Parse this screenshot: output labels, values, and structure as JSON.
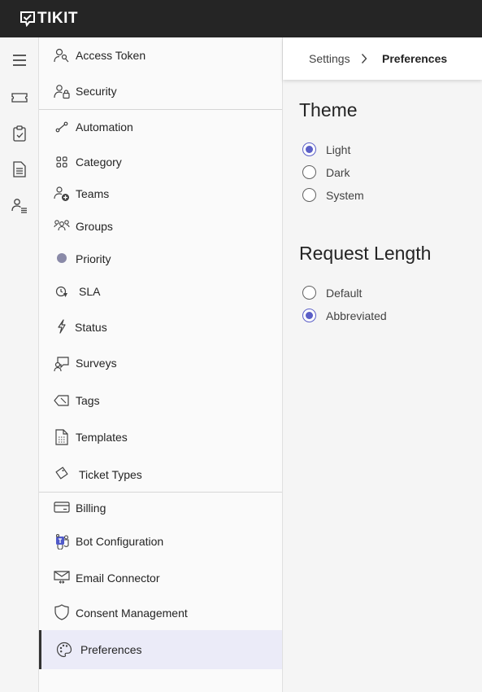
{
  "app": {
    "name": "TIKIT"
  },
  "rail": {
    "icons": [
      "hamburger-menu-icon",
      "ticket-icon",
      "clipboard-task-icon",
      "document-icon",
      "people-list-icon"
    ]
  },
  "nav": {
    "items": [
      {
        "label": "Access Token",
        "icon": "person-key-icon"
      },
      {
        "label": "Security",
        "icon": "people-lock-icon"
      },
      {
        "label": "Automation",
        "icon": "flow-icon"
      },
      {
        "label": "Category",
        "icon": "grid-icon"
      },
      {
        "label": "Teams",
        "icon": "people-add-icon"
      },
      {
        "label": "Groups",
        "icon": "people-community-icon"
      },
      {
        "label": "Priority",
        "icon": "circle-icon"
      },
      {
        "label": "SLA",
        "icon": "clock-alarm-icon"
      },
      {
        "label": "Status",
        "icon": "flash-icon"
      },
      {
        "label": "Surveys",
        "icon": "person-feedback-icon"
      },
      {
        "label": "Tags",
        "icon": "tag-icon"
      },
      {
        "label": "Templates",
        "icon": "document-dashed-icon"
      },
      {
        "label": "Ticket Types",
        "icon": "diamond-tag-icon"
      },
      {
        "label": "Billing",
        "icon": "wallet-card-icon"
      },
      {
        "label": "Bot Configuration",
        "icon": "teams-bot-icon"
      },
      {
        "label": "Email Connector",
        "icon": "mail-arrow-icon"
      },
      {
        "label": "Consent Management",
        "icon": "shield-icon"
      },
      {
        "label": "Preferences",
        "icon": "palette-icon"
      }
    ],
    "active": "Preferences"
  },
  "breadcrumb": {
    "parent": "Settings",
    "current": "Preferences"
  },
  "theme": {
    "title": "Theme",
    "options": [
      "Light",
      "Dark",
      "System"
    ],
    "selected": "Light"
  },
  "request_length": {
    "title": "Request Length",
    "options": [
      "Default",
      "Abbreviated"
    ],
    "selected": "Abbreviated"
  },
  "colors": {
    "accent": "#5b5fc7",
    "topbar": "#252525",
    "priority_dot": "#8a8aa8"
  }
}
